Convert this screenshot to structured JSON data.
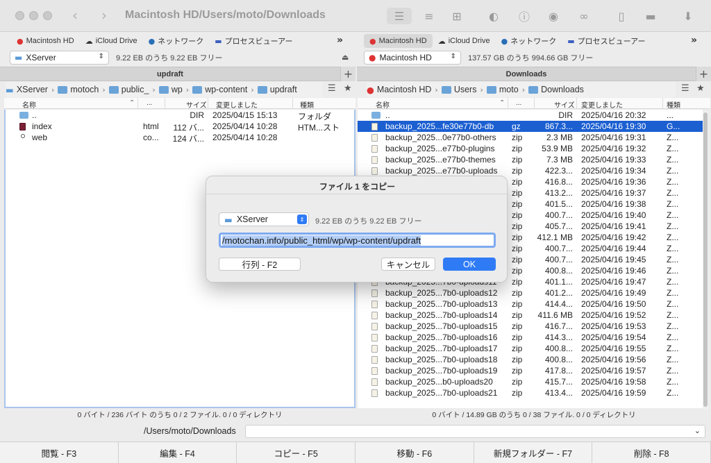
{
  "window": {
    "title": "Macintosh HD/Users/moto/Downloads"
  },
  "favorites_left": [
    {
      "label": "Macintosh HD",
      "icon": "apple-icon"
    },
    {
      "label": "iCloud Drive",
      "icon": "cloud-icon"
    },
    {
      "label": "ネットワーク",
      "icon": "globe-icon"
    },
    {
      "label": "プロセスビューアー",
      "icon": "monitor-icon"
    }
  ],
  "favorites_right": [
    {
      "label": "Macintosh HD",
      "icon": "apple-icon",
      "selected": true
    },
    {
      "label": "iCloud Drive",
      "icon": "cloud-icon"
    },
    {
      "label": "ネットワーク",
      "icon": "globe-icon"
    },
    {
      "label": "プロセスビューアー",
      "icon": "monitor-icon"
    }
  ],
  "left": {
    "volume": "XServer",
    "volume_info": "9.22 EB のうち 9.22 EB フリー",
    "tab": "updraft",
    "breadcrumb": [
      "XServer",
      "motoch",
      "public_",
      "wp",
      "wp-content",
      "updraft"
    ],
    "columns": {
      "name": "名称",
      "ext": "...",
      "size": "サイズ",
      "modified": "変更しました",
      "kind": "種類"
    },
    "files": [
      {
        "name": "..",
        "ext": "",
        "size": "DIR",
        "modified": "2025/04/15 15:13",
        "kind": "フォルダ",
        "icon": "dir"
      },
      {
        "name": "index",
        "ext": "html",
        "size": "112 バ...",
        "modified": "2025/04/14 10:28",
        "kind": "HTM...スト",
        "icon": "doc"
      },
      {
        "name": "web",
        "ext": "co...",
        "size": "124 バ...",
        "modified": "2025/04/14 10:28",
        "kind": "",
        "icon": "dot"
      }
    ],
    "status": "0 バイト / 236 バイト のうち 0 / 2 ファイル. 0 / 0 ディレクトリ"
  },
  "right": {
    "volume": "Macintosh HD",
    "volume_info": "137.57 GB のうち 994.66 GB フリー",
    "tab": "Downloads",
    "breadcrumb": [
      "Macintosh HD",
      "Users",
      "moto",
      "Downloads"
    ],
    "columns": {
      "name": "名称",
      "ext": "...",
      "size": "サイズ",
      "modified": "変更しました",
      "kind": "種類"
    },
    "files": [
      {
        "name": "..",
        "ext": "",
        "size": "DIR",
        "modified": "2025/04/16 20:32",
        "kind": "...",
        "icon": "dir"
      },
      {
        "name": "backup_2025...fe30e77b0-db",
        "ext": "gz",
        "size": "867.3...",
        "modified": "2025/04/16 19:30",
        "kind": "G...",
        "icon": "file",
        "selected": true
      },
      {
        "name": "backup_2025...0e77b0-others",
        "ext": "zip",
        "size": "2.3 MB",
        "modified": "2025/04/16 19:31",
        "kind": "Z...",
        "icon": "file"
      },
      {
        "name": "backup_2025...e77b0-plugins",
        "ext": "zip",
        "size": "53.9 MB",
        "modified": "2025/04/16 19:32",
        "kind": "Z...",
        "icon": "file"
      },
      {
        "name": "backup_2025...e77b0-themes",
        "ext": "zip",
        "size": "7.3 MB",
        "modified": "2025/04/16 19:33",
        "kind": "Z...",
        "icon": "file"
      },
      {
        "name": "backup_2025...e77b0-uploads",
        "ext": "zip",
        "size": "422.3...",
        "modified": "2025/04/16 19:34",
        "kind": "Z...",
        "icon": "file"
      },
      {
        "name": "",
        "ext": "zip",
        "size": "416.8...",
        "modified": "2025/04/16 19:36",
        "kind": "Z...",
        "icon": "file"
      },
      {
        "name": "",
        "ext": "zip",
        "size": "413.2...",
        "modified": "2025/04/16 19:37",
        "kind": "Z...",
        "icon": "file"
      },
      {
        "name": "",
        "ext": "zip",
        "size": "401.5...",
        "modified": "2025/04/16 19:38",
        "kind": "Z...",
        "icon": "file"
      },
      {
        "name": "",
        "ext": "zip",
        "size": "400.7...",
        "modified": "2025/04/16 19:40",
        "kind": "Z...",
        "icon": "file"
      },
      {
        "name": "",
        "ext": "zip",
        "size": "405.7...",
        "modified": "2025/04/16 19:41",
        "kind": "Z...",
        "icon": "file"
      },
      {
        "name": "",
        "ext": "zip",
        "size": "412.1 MB",
        "modified": "2025/04/16 19:42",
        "kind": "Z...",
        "icon": "file"
      },
      {
        "name": "",
        "ext": "zip",
        "size": "400.7...",
        "modified": "2025/04/16 19:44",
        "kind": "Z...",
        "icon": "file"
      },
      {
        "name": "",
        "ext": "zip",
        "size": "400.7...",
        "modified": "2025/04/16 19:45",
        "kind": "Z...",
        "icon": "file"
      },
      {
        "name": "",
        "ext": "zip",
        "size": "400.8...",
        "modified": "2025/04/16 19:46",
        "kind": "Z...",
        "icon": "file"
      },
      {
        "name": "backup_2025...7b0-uploads11",
        "ext": "zip",
        "size": "401.1...",
        "modified": "2025/04/16 19:47",
        "kind": "Z...",
        "icon": "file"
      },
      {
        "name": "backup_2025...7b0-uploads12",
        "ext": "zip",
        "size": "401.2...",
        "modified": "2025/04/16 19:49",
        "kind": "Z...",
        "icon": "file"
      },
      {
        "name": "backup_2025...7b0-uploads13",
        "ext": "zip",
        "size": "414.4...",
        "modified": "2025/04/16 19:50",
        "kind": "Z...",
        "icon": "file"
      },
      {
        "name": "backup_2025...7b0-uploads14",
        "ext": "zip",
        "size": "411.6 MB",
        "modified": "2025/04/16 19:52",
        "kind": "Z...",
        "icon": "file"
      },
      {
        "name": "backup_2025...7b0-uploads15",
        "ext": "zip",
        "size": "416.7...",
        "modified": "2025/04/16 19:53",
        "kind": "Z...",
        "icon": "file"
      },
      {
        "name": "backup_2025...7b0-uploads16",
        "ext": "zip",
        "size": "414.3...",
        "modified": "2025/04/16 19:54",
        "kind": "Z...",
        "icon": "file"
      },
      {
        "name": "backup_2025...7b0-uploads17",
        "ext": "zip",
        "size": "400.8...",
        "modified": "2025/04/16 19:55",
        "kind": "Z...",
        "icon": "file"
      },
      {
        "name": "backup_2025...7b0-uploads18",
        "ext": "zip",
        "size": "400.8...",
        "modified": "2025/04/16 19:56",
        "kind": "Z...",
        "icon": "file"
      },
      {
        "name": "backup_2025...7b0-uploads19",
        "ext": "zip",
        "size": "417.8...",
        "modified": "2025/04/16 19:57",
        "kind": "Z...",
        "icon": "file"
      },
      {
        "name": "backup_2025...b0-uploads20",
        "ext": "zip",
        "size": "415.7...",
        "modified": "2025/04/16 19:58",
        "kind": "Z...",
        "icon": "file"
      },
      {
        "name": "backup_2025...7b0-uploads21",
        "ext": "zip",
        "size": "413.4...",
        "modified": "2025/04/16 19:59",
        "kind": "Z...",
        "icon": "file"
      }
    ],
    "status": "0 バイト / 14.89 GB のうち 0 / 38 ファイル. 0 / 0 ディレクトリ"
  },
  "path": {
    "label": "/Users/moto/Downloads",
    "value": ""
  },
  "fkeys": [
    "閲覧 - F3",
    "編集 - F4",
    "コピー - F5",
    "移動 - F6",
    "新規フォルダー - F7",
    "削除 - F8"
  ],
  "dialog": {
    "title": "ファイル 1 をコピー",
    "volume": "XServer",
    "volume_info": "9.22 EB のうち 9.22 EB フリー",
    "path": "/motochan.info/public_html/wp/wp-content/updraft",
    "queue_label": "行列 - F2",
    "cancel_label": "キャンセル",
    "ok_label": "OK"
  },
  "colors": {
    "selection": "#1b5fd1",
    "accent": "#2f7bf5"
  }
}
